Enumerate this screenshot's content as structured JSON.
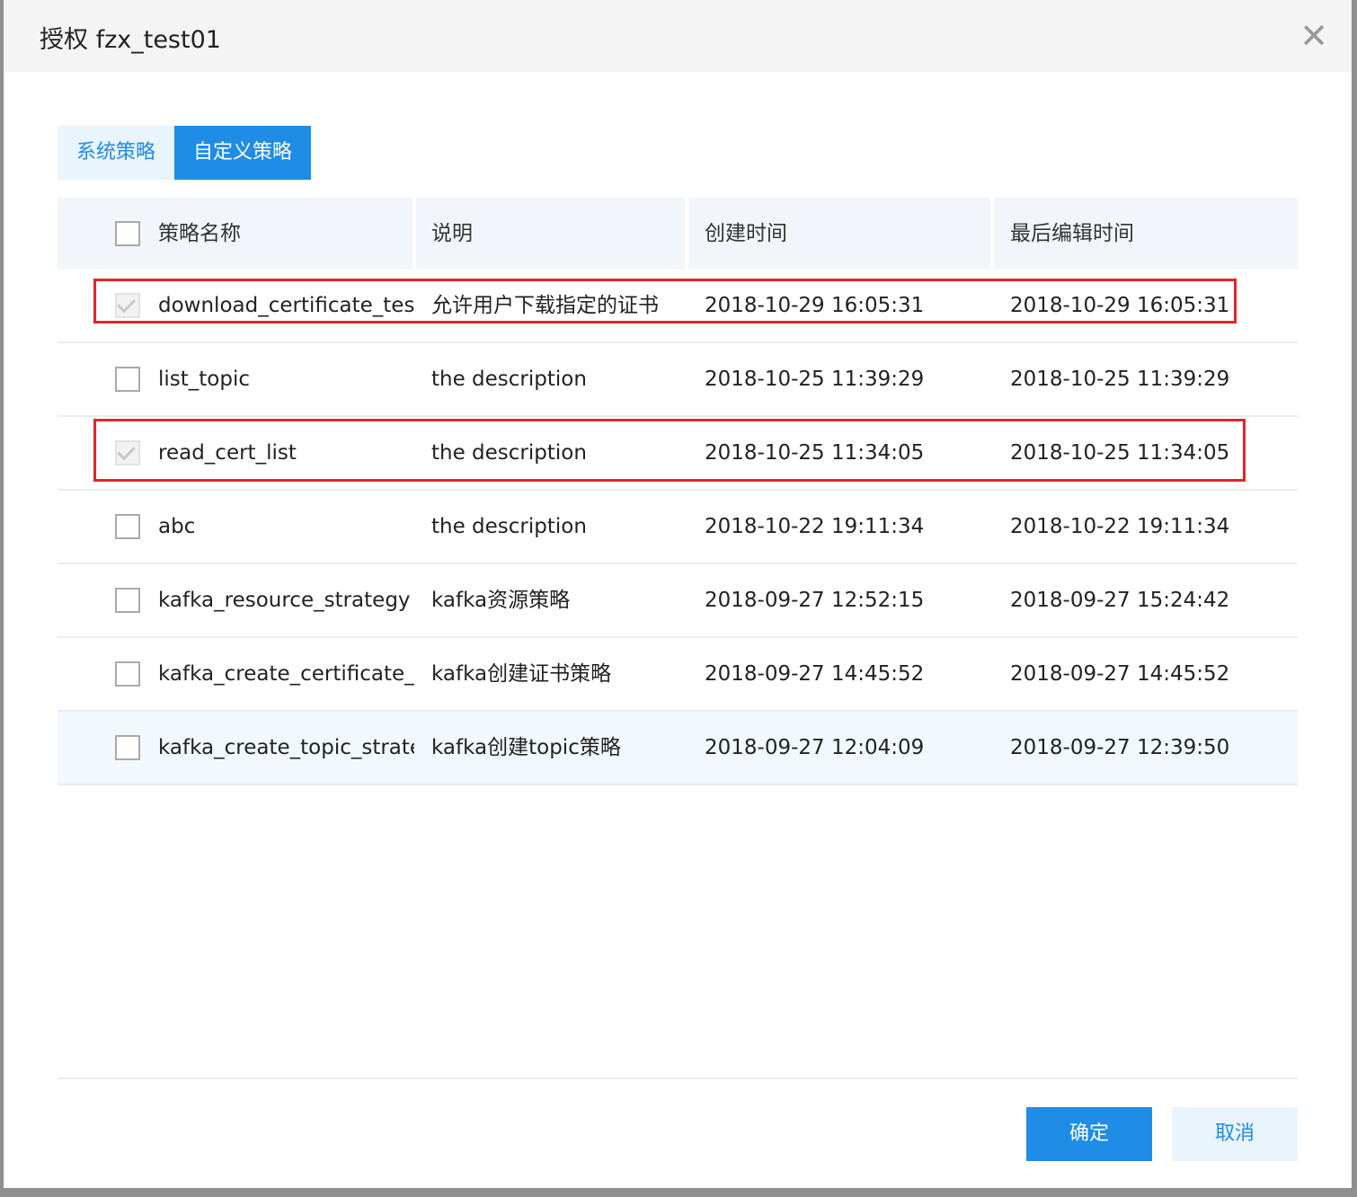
{
  "dialog": {
    "title": "授权 fzx_test01",
    "close_symbol": "✕"
  },
  "tabs": [
    {
      "label": "系统策略",
      "active": false
    },
    {
      "label": "自定义策略",
      "active": true
    }
  ],
  "table": {
    "columns": {
      "name": "策略名称",
      "description": "说明",
      "created": "创建时间",
      "edited": "最后编辑时间"
    },
    "header_checked": false,
    "rows": [
      {
        "checked": true,
        "disabled": true,
        "highlighted": true,
        "name": "download_certificate_test",
        "description": "允许用户下载指定的证书",
        "created": "2018-10-29 16:05:31",
        "edited": "2018-10-29 16:05:31"
      },
      {
        "checked": false,
        "disabled": false,
        "highlighted": false,
        "name": "list_topic",
        "description": "the description",
        "created": "2018-10-25 11:39:29",
        "edited": "2018-10-25 11:39:29"
      },
      {
        "checked": true,
        "disabled": true,
        "highlighted": true,
        "name": "read_cert_list",
        "description": "the description",
        "created": "2018-10-25 11:34:05",
        "edited": "2018-10-25 11:34:05"
      },
      {
        "checked": false,
        "disabled": false,
        "highlighted": false,
        "name": "abc",
        "description": "the description",
        "created": "2018-10-22 19:11:34",
        "edited": "2018-10-22 19:11:34"
      },
      {
        "checked": false,
        "disabled": false,
        "highlighted": false,
        "name": "kafka_resource_strategy",
        "description": "kafka资源策略",
        "created": "2018-09-27 12:52:15",
        "edited": "2018-09-27 15:24:42"
      },
      {
        "checked": false,
        "disabled": false,
        "highlighted": false,
        "name": "kafka_create_certificate_strategy",
        "description": "kafka创建证书策略",
        "created": "2018-09-27 14:45:52",
        "edited": "2018-09-27 14:45:52"
      },
      {
        "checked": false,
        "disabled": false,
        "highlighted": false,
        "name": "kafka_create_topic_strategy",
        "description": "kafka创建topic策略",
        "created": "2018-09-27 12:04:09",
        "edited": "2018-09-27 12:39:50"
      }
    ]
  },
  "footer": {
    "ok_label": "确定",
    "cancel_label": "取消"
  },
  "colors": {
    "primary": "#1f8ce6",
    "highlight_border": "#e4242b"
  }
}
